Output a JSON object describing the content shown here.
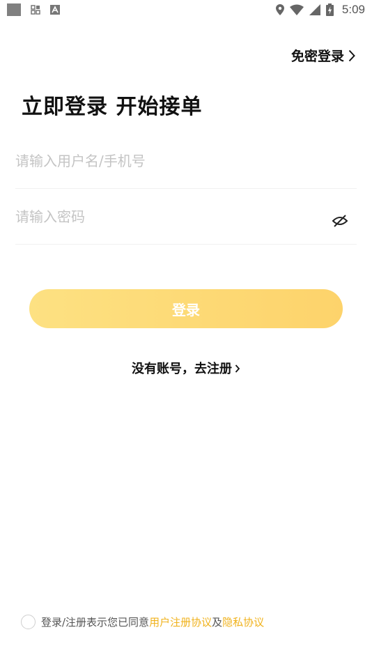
{
  "status_bar": {
    "time": "5:09",
    "icons": [
      "app-square-icon",
      "grid-apps-icon",
      "font-a-icon",
      "location-icon",
      "wifi-icon",
      "cell-signal-icon",
      "battery-charging-icon"
    ]
  },
  "header": {
    "passwordless_label": "免密登录"
  },
  "title": "立即登录 开始接单",
  "form": {
    "username_placeholder": "请输入用户名/手机号",
    "password_placeholder": "请输入密码",
    "submit_label": "登录"
  },
  "register": {
    "label": "没有账号，去注册"
  },
  "agreement": {
    "prefix": "登录/注册表示您已同意",
    "user_agreement": "用户注册协议",
    "and": "及",
    "privacy": "隐私协议"
  },
  "colors": {
    "accent": "#f0b21c",
    "button_start": "#fde182",
    "button_end": "#fdd36b"
  }
}
